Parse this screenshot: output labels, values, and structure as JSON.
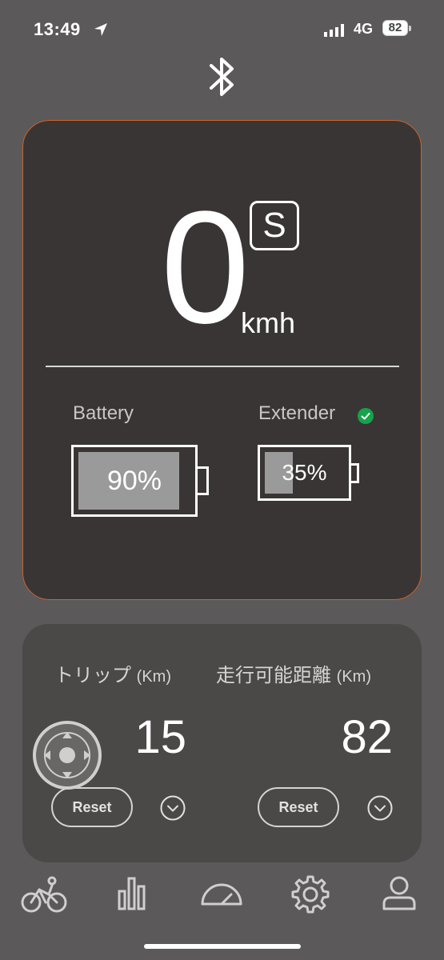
{
  "status_bar": {
    "time": "13:49",
    "network": "4G",
    "battery": "82"
  },
  "speed": {
    "value": "0",
    "unit": "kmh",
    "mode": "S"
  },
  "battery": {
    "label": "Battery",
    "percent_text": "90%",
    "level": 90
  },
  "extender": {
    "label": "Extender",
    "percent_text": "35%",
    "level": 35
  },
  "trip": {
    "label": "トリップ",
    "unit": "(Km)",
    "value": "15",
    "reset_label": "Reset"
  },
  "range": {
    "label": "走行可能距離",
    "unit": "(Km)",
    "value": "82",
    "reset_label": "Reset"
  },
  "tabs": [
    {
      "icon": "bicycle-icon"
    },
    {
      "icon": "bar-chart-icon"
    },
    {
      "icon": "speedometer-icon"
    },
    {
      "icon": "gear-icon"
    },
    {
      "icon": "profile-icon"
    }
  ],
  "colors": {
    "accent": "#c9642c",
    "check": "#16a34a",
    "background": "#5b5959",
    "card": "#3a3535"
  }
}
